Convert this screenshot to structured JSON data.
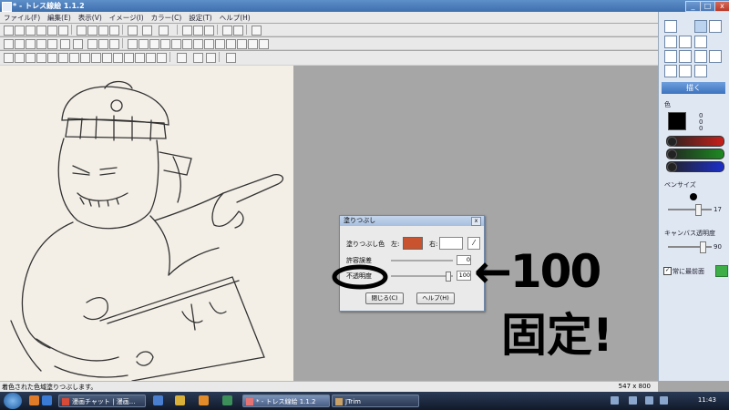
{
  "window": {
    "title": "* - トレス線絵 1.1.2"
  },
  "menu": [
    "ファイル(F)",
    "編集(E)",
    "表示(V)",
    "イメージ(I)",
    "カラー(C)",
    "設定(T)",
    "ヘルプ(H)"
  ],
  "right_panel": {
    "draw_label": "描く",
    "color_label": "色",
    "rgb_values": [
      "0",
      "0",
      "0"
    ],
    "pen_size_label": "ペンサイズ",
    "pen_size_value": "17",
    "opacity_label": "キャンバス透明度",
    "opacity_value": "90",
    "topmost_label": "常に最前面",
    "colors": {
      "current": "#000000",
      "red": "#c8201a",
      "green": "#1d8a22",
      "blue": "#1c2fc9",
      "accent": "#4f86d8"
    }
  },
  "dialog": {
    "title": "塗りつぶし",
    "fill_color_label": "塗りつぶし色",
    "left_label": "左:",
    "right_label": "右:",
    "field1_label": "許容誤差",
    "field1_value": "0",
    "opacity_label": "不透明度",
    "opacity_value": "100",
    "close_button": "閉じる(C)",
    "help_button": "ヘルプ(H)",
    "left_color": "#c8532e",
    "right_color": "#ffffff"
  },
  "status": {
    "message": "着色された色域塗りつぶします。",
    "canvas_size": "547 x 800"
  },
  "annotation": {
    "line1": "←100",
    "line2": "固定!"
  },
  "taskbar": {
    "tasks": [
      "漫画チャット | 漫画...",
      "* - トレス線絵 1.1.2",
      "JTrim"
    ],
    "clock": "11:43"
  }
}
